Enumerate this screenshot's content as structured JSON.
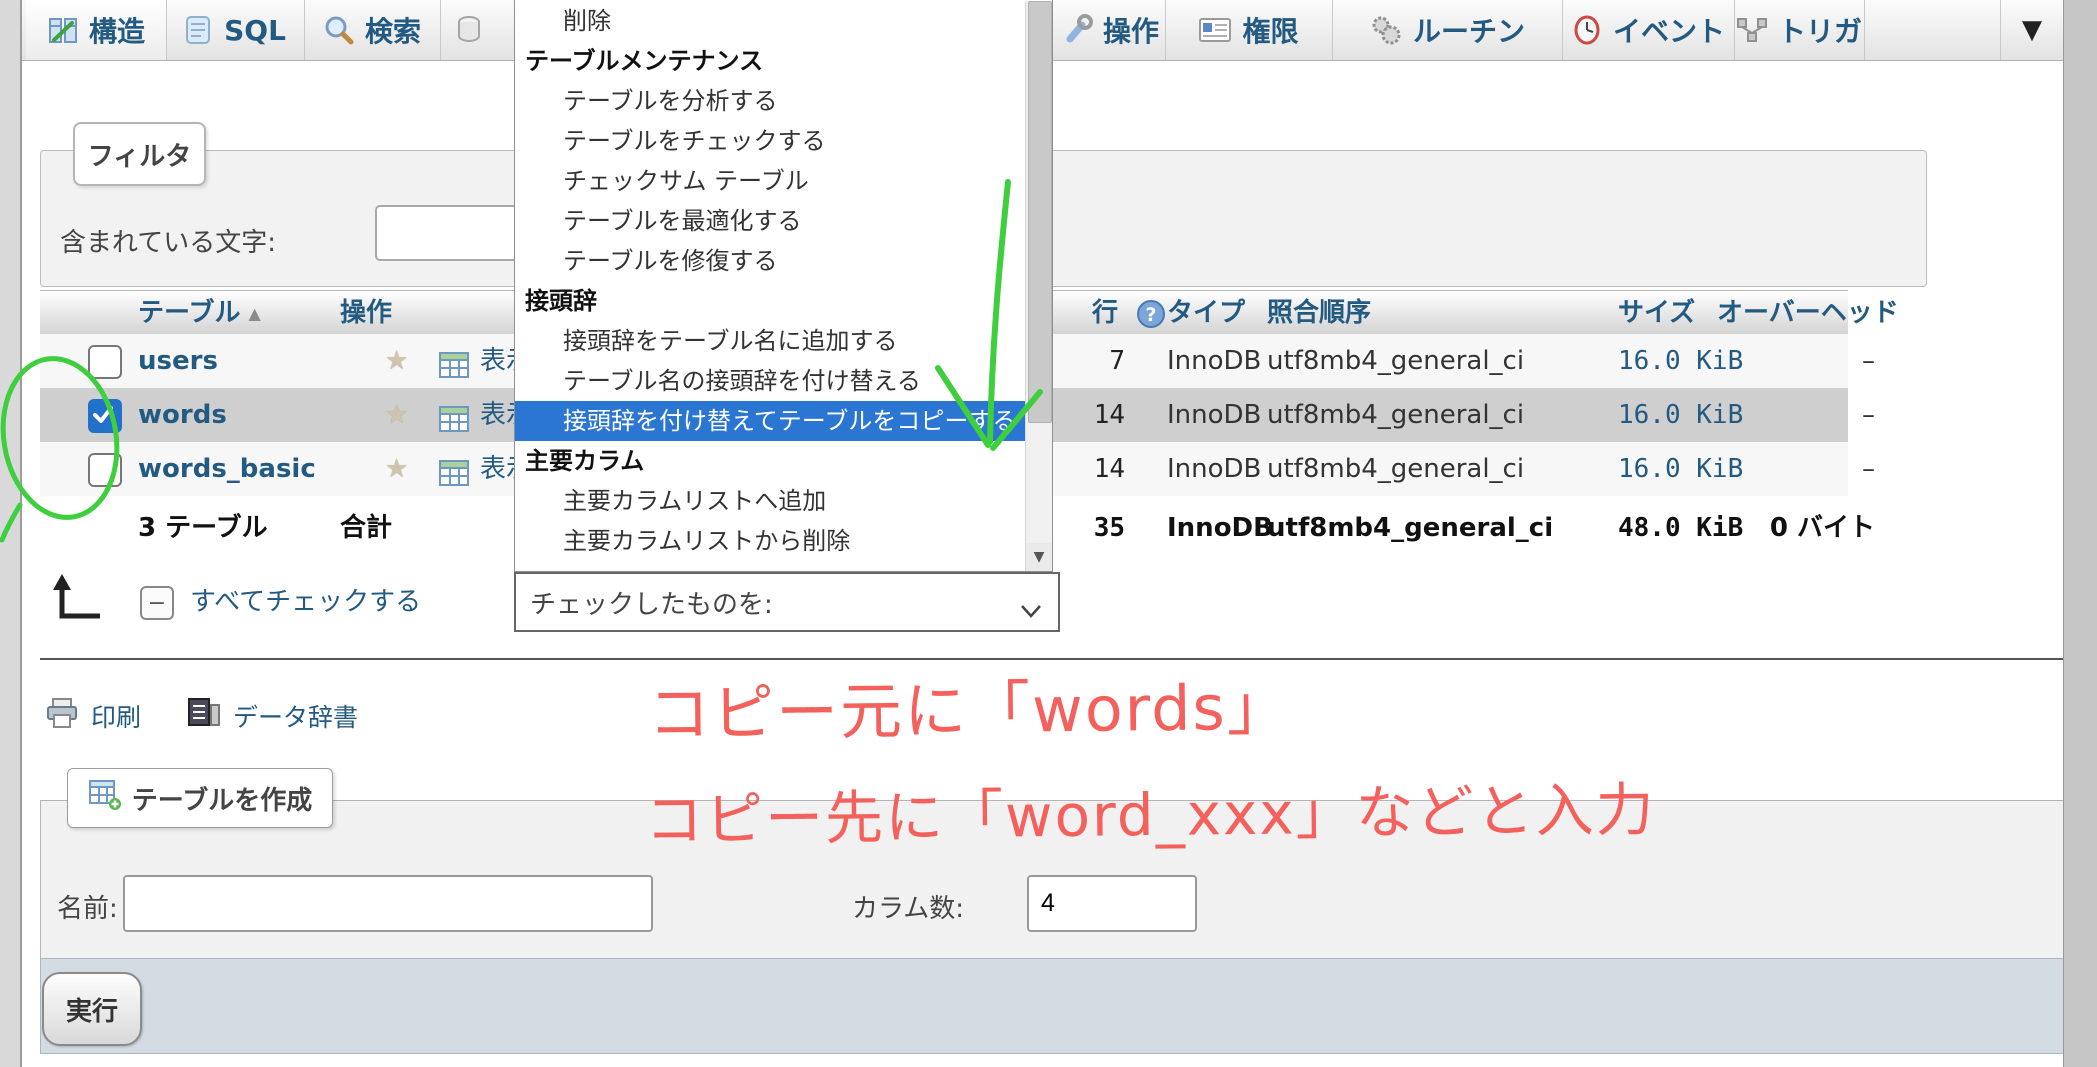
{
  "colors": {
    "link_blue": "#235a81",
    "menu_highlight": "#2a76d2",
    "annotation_red": "#f4605c",
    "annotation_green": "#3ece3e",
    "footer_bar": "#d3dce3"
  },
  "tabs": {
    "items": [
      {
        "label": "構造",
        "active": true
      },
      {
        "label": "SQL",
        "active": false
      },
      {
        "label": "検索",
        "active": false
      },
      {
        "label": "操作",
        "active": false
      },
      {
        "label": "権限",
        "active": false
      },
      {
        "label": "ルーチン",
        "active": false
      },
      {
        "label": "イベント",
        "active": false
      },
      {
        "label": "トリガ",
        "active": false
      }
    ]
  },
  "context_menu": {
    "items": [
      {
        "label": "削除",
        "kind": "item",
        "selected": false
      },
      {
        "label": "テーブルメンテナンス",
        "kind": "header",
        "selected": false
      },
      {
        "label": "テーブルを分析する",
        "kind": "item",
        "selected": false
      },
      {
        "label": "テーブルをチェックする",
        "kind": "item",
        "selected": false
      },
      {
        "label": "チェックサム テーブル",
        "kind": "item",
        "selected": false
      },
      {
        "label": "テーブルを最適化する",
        "kind": "item",
        "selected": false
      },
      {
        "label": "テーブルを修復する",
        "kind": "item",
        "selected": false
      },
      {
        "label": "接頭辞",
        "kind": "header",
        "selected": false
      },
      {
        "label": "接頭辞をテーブル名に追加する",
        "kind": "item",
        "selected": false
      },
      {
        "label": "テーブル名の接頭辞を付け替える",
        "kind": "item",
        "selected": false
      },
      {
        "label": "接頭辞を付け替えてテーブルをコピーする",
        "kind": "item",
        "selected": true
      },
      {
        "label": "主要カラム",
        "kind": "header",
        "selected": false
      },
      {
        "label": "主要カラムリストへ追加",
        "kind": "item",
        "selected": false
      },
      {
        "label": "主要カラムリストから削除",
        "kind": "item",
        "selected": false
      }
    ]
  },
  "filter": {
    "legend": "フィルタ",
    "label": "含まれている文字:",
    "value": ""
  },
  "table": {
    "headers": {
      "name": "テーブル",
      "action": "操作",
      "rows": "行",
      "type": "タイプ",
      "collation": "照合順序",
      "size": "サイズ",
      "overhead": "オーバーヘッド"
    },
    "row_action_label": "表示",
    "rows": [
      {
        "name": "users",
        "checked": false,
        "rows": "7",
        "type": "InnoDB",
        "collation": "utf8mb4_general_ci",
        "size": "16.0 KiB",
        "overhead": "–"
      },
      {
        "name": "words",
        "checked": true,
        "rows": "14",
        "type": "InnoDB",
        "collation": "utf8mb4_general_ci",
        "size": "16.0 KiB",
        "overhead": "–"
      },
      {
        "name": "words_basic",
        "checked": false,
        "rows": "14",
        "type": "InnoDB",
        "collation": "utf8mb4_general_ci",
        "size": "16.0 KiB",
        "overhead": "–"
      }
    ],
    "totals": {
      "count_label": "3 テーブル",
      "sum_label": "合計",
      "rows": "35",
      "type": "InnoDB",
      "collation": "utf8mb4_general_ci",
      "size": "48.0 KiB",
      "overhead": "0 バイト"
    }
  },
  "footer_controls": {
    "check_all_label": "すべてチェックする",
    "with_selected_label": "チェックしたものを:"
  },
  "links": {
    "print": "印刷",
    "data_dictionary": "データ辞書"
  },
  "create_table": {
    "title": "テーブルを作成",
    "name_label": "名前:",
    "name_value": "",
    "columns_label": "カラム数:",
    "columns_value": "4",
    "submit_label": "実行"
  },
  "annotations": {
    "line1": "コピー元に「words」",
    "line2": "コピー先に「word_xxx」などと入力"
  }
}
